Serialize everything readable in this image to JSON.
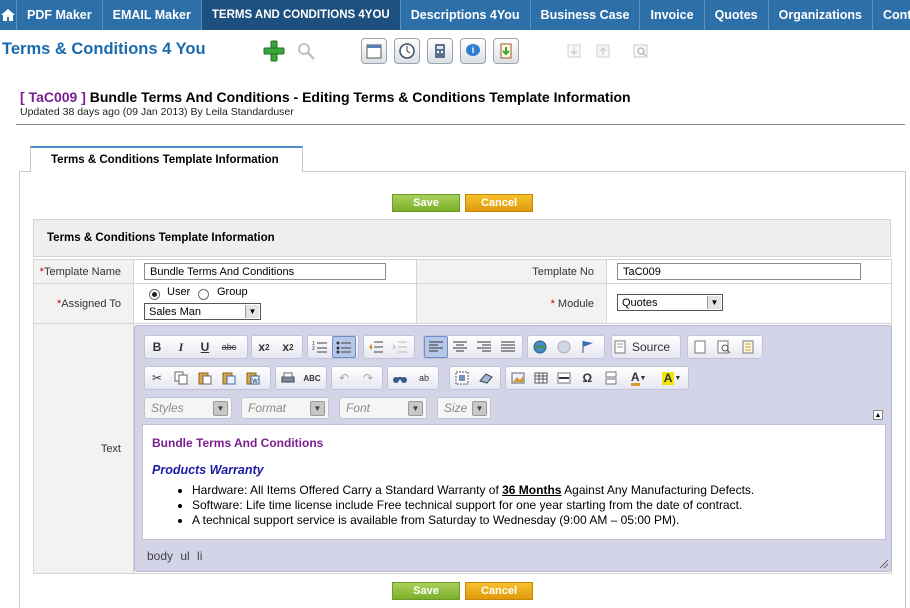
{
  "nav": {
    "tabs": [
      {
        "label": "PDF Maker"
      },
      {
        "label": "EMAIL Maker"
      },
      {
        "label": "TERMS AND CONDITIONS 4YOU"
      },
      {
        "label": "Descriptions 4You"
      },
      {
        "label": "Business Case"
      },
      {
        "label": "Invoice"
      },
      {
        "label": "Quotes"
      },
      {
        "label": "Organizations"
      },
      {
        "label": "Contacts"
      }
    ],
    "active_index": 2
  },
  "app": {
    "title": "Terms & Conditions 4 You"
  },
  "header_icons": [
    "add-icon",
    "search-icon",
    "calendar-icon",
    "clock-icon",
    "calculator-icon",
    "chat-icon",
    "import-icon",
    "import-disabled-icon",
    "export-disabled-icon",
    "find-duplicates-icon"
  ],
  "record": {
    "number": "[ TaC009 ]",
    "title": "Bundle Terms And Conditions - Editing Terms & Conditions Template Information",
    "updated": "Updated 38 days ago (09 Jan 2013) By Leila Standarduser"
  },
  "tab": {
    "label": "Terms & Conditions Template Information"
  },
  "buttons": {
    "save": "Save",
    "cancel": "Cancel"
  },
  "section": {
    "title": "Terms & Conditions Template Information"
  },
  "form": {
    "template_name_label": "Template Name",
    "template_name_value": "Bundle Terms And Conditions",
    "template_no_label": "Template No",
    "template_no_value": "TaC009",
    "assigned_to_label": "Assigned To",
    "radio_user": "User",
    "radio_group": "Group",
    "assigned_value": "Sales Man",
    "module_label": "Module",
    "module_value": "Quotes",
    "text_label": "Text",
    "required_mark": "*"
  },
  "editor": {
    "combos": {
      "styles": "Styles",
      "format": "Format",
      "font": "Font",
      "size": "Size"
    },
    "source_label": "Source",
    "heading": "Bundle Terms And Conditions",
    "subheading": "Products Warranty",
    "bullets": [
      {
        "before": "Hardware: All Items Offered Carry a Standard Warranty of ",
        "bold": "36 Months",
        "after": " Against Any Manufacturing Defects."
      },
      {
        "before": "Software: Life time license include Free technical support for one year starting from the date of contract.",
        "bold": "",
        "after": ""
      },
      {
        "before": "A technical support service is available from Saturday to Wednesday (9:00 AM – 05:00 PM).",
        "bold": "",
        "after": ""
      }
    ],
    "path": "body ul li"
  },
  "colors": {
    "nav_bg": "#2c6fa9",
    "nav_active": "#1d4f7f",
    "title_blue": "#1a6aae",
    "record_no": "#7b1f8f",
    "save_green": "#8bbf3a",
    "cancel_orange": "#eda91c"
  }
}
